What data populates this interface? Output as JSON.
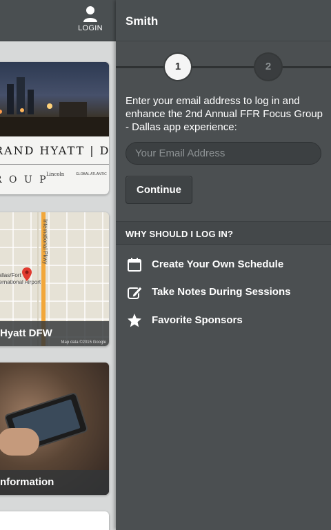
{
  "left_panel": {
    "login_label": "LOGIN",
    "cards": [
      {
        "hotel_name": "RAND HYATT | DFW",
        "group_text": "R O U P",
        "sponsor_1": "Lincoln",
        "sponsor_2": "GLOBAL ATLANTIC"
      },
      {
        "caption": "Hyatt DFW",
        "map_labels": [
          "International Pkwy",
          "Dallas/Fort W",
          "nternational Airport"
        ],
        "map_attribution": "Map data ©2015 Google"
      },
      {
        "caption": "nformation"
      }
    ]
  },
  "drawer": {
    "user_name": "Smith",
    "steps": [
      "1",
      "2"
    ],
    "active_step": 1,
    "intro_text": "Enter your email address to log in and enhance the 2nd Annual FFR Focus Group - Dallas app experience:",
    "email_placeholder": "Your Email Address",
    "email_value": "",
    "continue_label": "Continue",
    "why_title": "WHY SHOULD I LOG IN?",
    "benefits": [
      {
        "icon": "calendar-icon",
        "label": "Create Your Own Schedule"
      },
      {
        "icon": "note-edit-icon",
        "label": "Take Notes During Sessions"
      },
      {
        "icon": "star-icon",
        "label": "Favorite Sponsors"
      }
    ]
  },
  "colors": {
    "drawer_bg": "#4b4f51",
    "header_bg": "#4a4f51",
    "left_bg": "#d7d9d9",
    "text": "#ffffff",
    "map_road": "#f2a73a",
    "pin": "#e03a2f"
  }
}
